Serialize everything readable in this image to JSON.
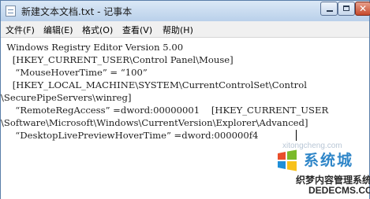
{
  "window": {
    "title": "新建文本文档.txt - 记事本",
    "icon": "notepad-icon"
  },
  "menu": {
    "items": [
      {
        "label": "文件(F)"
      },
      {
        "label": "编辑(E)"
      },
      {
        "label": "格式(O)"
      },
      {
        "label": "查看(V)"
      },
      {
        "label": "帮助(H)"
      }
    ]
  },
  "editor": {
    "lines": [
      "  Windows Registry Editor Version 5.00",
      "    [HKEY_CURRENT_USER\\Control Panel\\Mouse]",
      "     “MouseHoverTime” = “100”",
      "    [HKEY_LOCAL_MACHINE\\SYSTEM\\CurrentControlSet\\Control",
      "\\SecurePipeServers\\winreg]",
      "     “RemoteRegAccess” =dword:00000001    [HKEY_CURRENT_USER",
      "\\Software\\Microsoft\\Windows\\CurrentVersion\\Explorer\\Advanced]",
      "     “DesktopLivePreviewHoverTime” =dword:000000f4"
    ]
  },
  "watermark": {
    "brand": "系统城",
    "subtitle": "织梦内容管理系统",
    "url": "DEDECMS.COM",
    "faint": "xitongcheng.com"
  }
}
